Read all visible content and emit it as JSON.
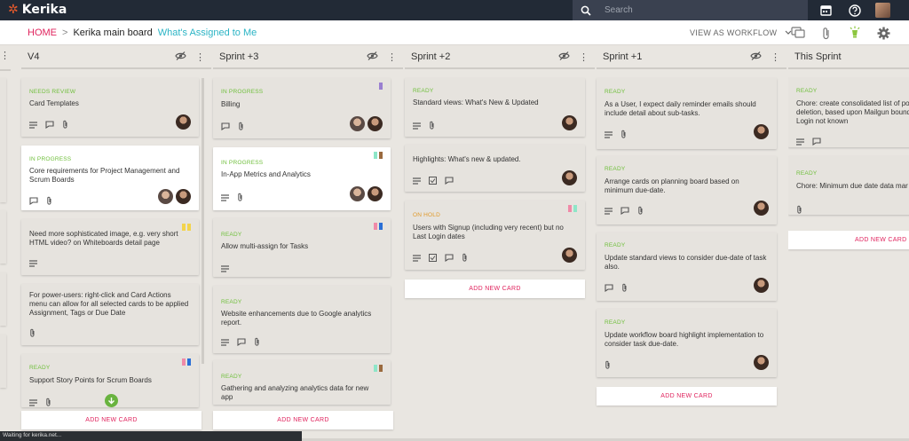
{
  "app": {
    "name": "Kerika"
  },
  "search": {
    "placeholder": "Search"
  },
  "breadcrumb": {
    "home": "HOME",
    "separator": ">",
    "board": "Kerika main board",
    "view": "What's Assigned to Me"
  },
  "toolbar": {
    "view_as": "VIEW AS WORKFLOW"
  },
  "colors": {
    "accent_pink": "#e0245e",
    "ready_green": "#6fbf3b",
    "hold_orange": "#e09a2b",
    "view_teal": "#2bb4c5",
    "topbar": "#222a36"
  },
  "add_card_label": "ADD NEW CARD",
  "status_text": "Waiting for kerika.net...",
  "columns": [
    {
      "title": "V4",
      "cards": [
        {
          "status": "NEEDS REVIEW",
          "title": "Card Templates",
          "icons": [
            "list-icon",
            "chat-icon",
            "paperclip-icon"
          ],
          "people": 1
        },
        {
          "status": "IN PROGRESS",
          "title": "Core requirements for Project Management and Scrum Boards",
          "icons": [
            "chat-icon",
            "paperclip-icon"
          ],
          "people": 2
        },
        {
          "status": "",
          "title": "Need more sophisticated image, e.g. very short HTML video? on Whiteboards detail page",
          "icons": [
            "list-icon"
          ],
          "people": 0
        },
        {
          "status": "",
          "title": "For power-users: right-click and Card Actions menu can allow for all selected cards to be applied Assignment, Tags or Due Date",
          "icons": [
            "paperclip-icon"
          ],
          "people": 0
        },
        {
          "status": "READY",
          "title": "Support Story Points for Scrum Boards",
          "icons": [
            "list-icon",
            "paperclip-icon"
          ],
          "people": 0
        }
      ]
    },
    {
      "title": "Sprint +3",
      "cards": [
        {
          "status": "IN PROGRESS",
          "title": "Billing",
          "icons": [
            "chat-icon",
            "paperclip-icon"
          ],
          "people": 2
        },
        {
          "status": "IN PROGRESS",
          "title": "In-App Metrics and Analytics",
          "icons": [
            "list-icon",
            "paperclip-icon"
          ],
          "people": 2
        },
        {
          "status": "READY",
          "title": "Allow multi-assign for Tasks",
          "icons": [
            "list-icon"
          ],
          "people": 0
        },
        {
          "status": "READY",
          "title": "Website enhancements due to Google analytics report.",
          "icons": [
            "list-icon",
            "chat-icon",
            "paperclip-icon"
          ],
          "people": 0
        },
        {
          "status": "READY",
          "title": "Gathering and analyzing analytics data for new app",
          "icons": [],
          "people": 0
        }
      ]
    },
    {
      "title": "Sprint +2",
      "cards": [
        {
          "status": "READY",
          "title": "Standard views: What's New & Updated",
          "icons": [
            "list-icon",
            "paperclip-icon"
          ],
          "people": 1
        },
        {
          "status": "",
          "title": "Highlights: What's new & updated.",
          "icons": [
            "list-icon",
            "checklist-icon",
            "chat-icon"
          ],
          "people": 1
        },
        {
          "status": "ON HOLD",
          "title": "Users with Signup (including very recent) but no Last Login dates",
          "icons": [
            "list-icon",
            "checklist-icon",
            "chat-icon",
            "paperclip-icon"
          ],
          "people": 1
        }
      ]
    },
    {
      "title": "Sprint +1",
      "cards": [
        {
          "status": "READY",
          "title": "As a User, I expect daily reminder emails should include detail about sub-tasks.",
          "icons": [
            "list-icon",
            "paperclip-icon"
          ],
          "people": 1
        },
        {
          "status": "READY",
          "title": "Arrange cards on planning board based on minimum due-date.",
          "icons": [
            "list-icon",
            "chat-icon",
            "paperclip-icon"
          ],
          "people": 1
        },
        {
          "status": "READY",
          "title": "Update standard views to consider due-date of task also.",
          "icons": [
            "chat-icon",
            "paperclip-icon"
          ],
          "people": 1
        },
        {
          "status": "READY",
          "title": "Update workflow board highlight implementation to consider task due-date.",
          "icons": [
            "paperclip-icon"
          ],
          "people": 1
        }
      ]
    },
    {
      "title": "This Sprint",
      "cards": [
        {
          "status": "READY",
          "title": "Chore: create consolidated list of po deletion, based upon Mailgun bound Login not known",
          "icons": [
            "list-icon",
            "chat-icon"
          ],
          "people": 0
        },
        {
          "status": "READY",
          "title": "Chore: Minimum due date data mar",
          "icons": [
            "paperclip-icon"
          ],
          "people": 0
        }
      ]
    }
  ]
}
